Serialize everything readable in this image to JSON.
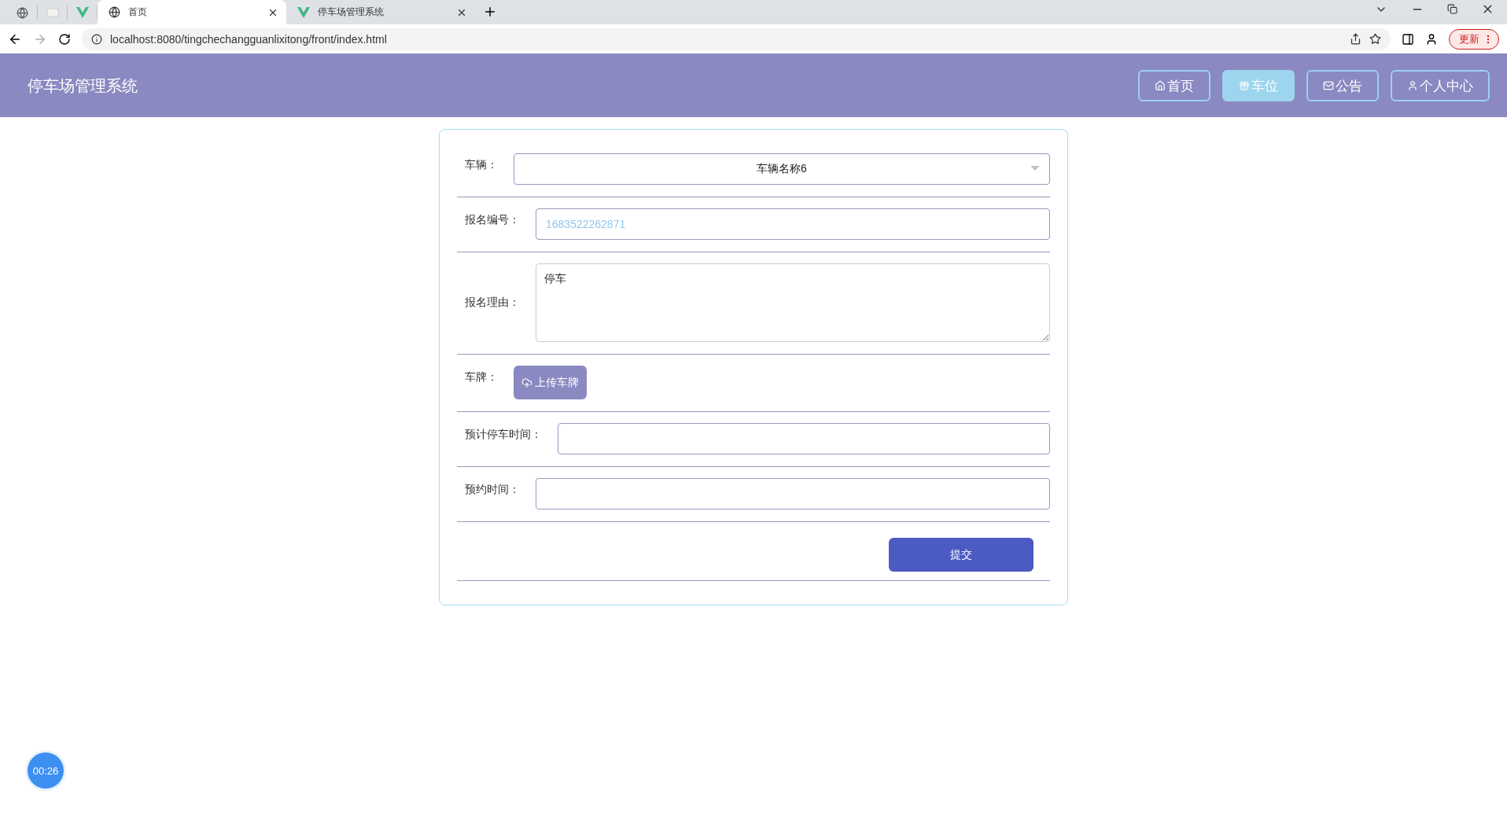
{
  "browser": {
    "tabs": [
      {
        "title": "首页",
        "selected": true
      },
      {
        "title": "停车场管理系统",
        "selected": false
      }
    ],
    "url": "localhost:8080/tingchechangguanlixitong/front/index.html",
    "update_button": "更新"
  },
  "header": {
    "title": "停车场管理系统",
    "nav": [
      {
        "label": "首页",
        "selected": false
      },
      {
        "label": "车位",
        "selected": true
      },
      {
        "label": "公告",
        "selected": false
      },
      {
        "label": "个人中心",
        "selected": false
      }
    ]
  },
  "form": {
    "fields": [
      {
        "kind": "select",
        "label": "车辆：",
        "value": "车辆名称6"
      },
      {
        "kind": "readonly",
        "label": "报名编号：",
        "value": "1683522262871"
      },
      {
        "kind": "textarea",
        "label": "报名理由：",
        "value": "停车"
      },
      {
        "kind": "upload",
        "label": "车牌：",
        "button": "上传车牌"
      },
      {
        "kind": "text",
        "label": "预计停车时间："
      },
      {
        "kind": "text",
        "label": "预约时间："
      }
    ],
    "submit": "提交"
  },
  "timer": "00:26"
}
